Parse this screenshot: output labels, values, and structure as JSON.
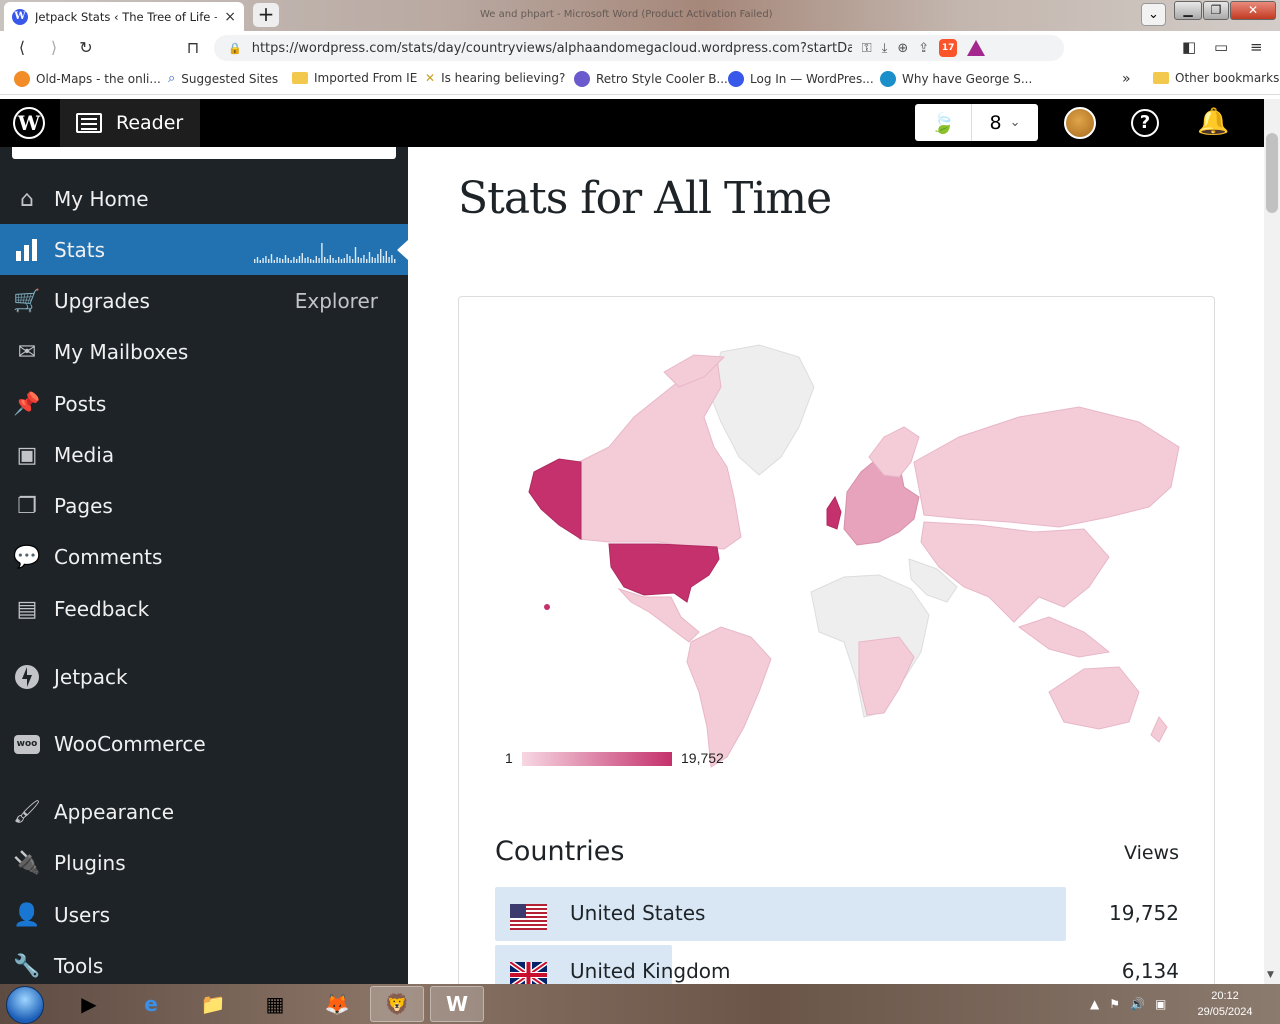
{
  "browser": {
    "tab_title": "Jetpack Stats ‹ The Tree of Life —",
    "tab_close": "×",
    "new_tab": "+",
    "window_title": "We and phpart - Microsoft Word (Product Activation Failed)",
    "url": "https://wordpress.com/stats/day/countryviews/alphaandomegacloud.wordpress.com?startDate...",
    "nav": {
      "back": "⟨",
      "forward": "⟩",
      "reload": "↻",
      "bookmark": "⊓"
    },
    "shield_count": "17"
  },
  "bookmarks": [
    {
      "label": "Old-Maps - the onli...",
      "color": "#f28c28"
    },
    {
      "label": "Suggested Sites",
      "color": "#2a63c8"
    },
    {
      "label": "Imported From IE",
      "color": "folder"
    },
    {
      "label": "Is hearing believing?",
      "color": "#c8a020"
    },
    {
      "label": "Retro Style Cooler B...",
      "color": "#6a5acd"
    },
    {
      "label": "Log In — WordPres...",
      "color": "#3858e9"
    },
    {
      "label": "Why have George S...",
      "color": "#1a8fc9"
    }
  ],
  "bookmarks_more": "»",
  "other_bookmarks": "Other bookmarks",
  "masterbar": {
    "logo": "W",
    "reader": "Reader",
    "site_count": "8",
    "help": "?"
  },
  "sidebar": {
    "items": [
      {
        "label": "My Home",
        "icon": "home-icon",
        "glyph": "⌂"
      },
      {
        "label": "Stats",
        "icon": "stats-icon",
        "glyph": "▮"
      },
      {
        "label": "Upgrades",
        "icon": "cart-icon",
        "glyph": "🛒",
        "aside": "Explorer"
      },
      {
        "label": "My Mailboxes",
        "icon": "mail-icon",
        "glyph": "✉"
      },
      {
        "label": "Posts",
        "icon": "pin-icon",
        "glyph": "📌"
      },
      {
        "label": "Media",
        "icon": "media-icon",
        "glyph": "▣"
      },
      {
        "label": "Pages",
        "icon": "pages-icon",
        "glyph": "❐"
      },
      {
        "label": "Comments",
        "icon": "comment-icon",
        "glyph": "💬"
      },
      {
        "label": "Feedback",
        "icon": "feedback-icon",
        "glyph": "▤"
      },
      {
        "label": "Jetpack",
        "icon": "jetpack-icon",
        "glyph": "ϟ"
      },
      {
        "label": "WooCommerce",
        "icon": "woo-icon",
        "glyph": "W"
      },
      {
        "label": "Appearance",
        "icon": "brush-icon",
        "glyph": "🖌"
      },
      {
        "label": "Plugins",
        "icon": "plugin-icon",
        "glyph": "🔌"
      },
      {
        "label": "Users",
        "icon": "user-icon",
        "glyph": "👤"
      },
      {
        "label": "Tools",
        "icon": "wrench-icon",
        "glyph": "🔧"
      }
    ]
  },
  "main": {
    "title": "Stats for All Time",
    "legend_min": "1",
    "legend_max": "19,752",
    "countries_heading": "Countries",
    "views_heading": "Views",
    "rows": [
      {
        "country": "United States",
        "views": "19,752",
        "share": 1.0
      },
      {
        "country": "United Kingdom",
        "views": "6,134",
        "share": 0.31
      }
    ]
  },
  "colors": {
    "sidebar_bg": "#1d2327",
    "active_blue": "#2271b1",
    "map_low": "#f3ccd8",
    "map_mid": "#e6a3bb",
    "map_high": "#c4316c",
    "map_none": "#eeeeee",
    "row_bar": "#d9e7f4"
  },
  "taskbar": {
    "time": "20:12",
    "date": "29/05/2024"
  }
}
